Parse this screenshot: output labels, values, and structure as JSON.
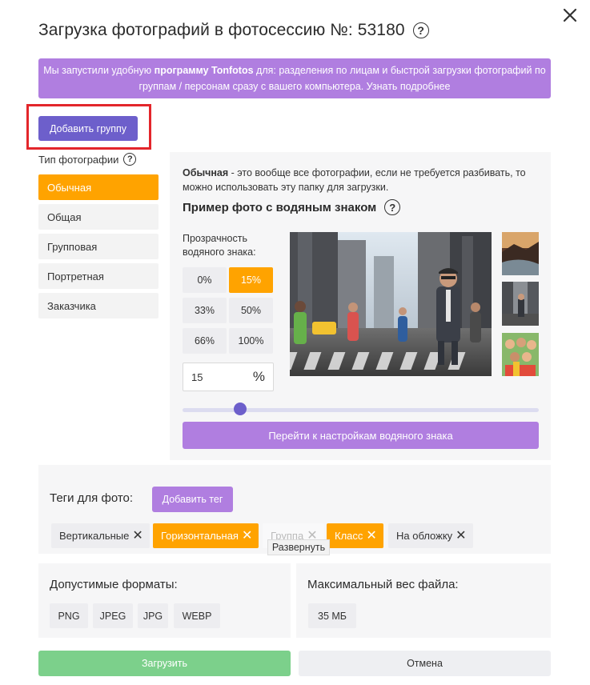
{
  "dialog": {
    "title": "Загрузка фотографий в фотосессию №: 53180",
    "help_icon": "?"
  },
  "banner": {
    "text_before": "Мы запустили удобную",
    "text_bold": "программу Tonfotos",
    "text_after": "для: разделения по лицам и быстрой загрузки фотографий по группам / персонам сразу с вашего компьютера. Узнать подробнее"
  },
  "add_group_label": "Добавить группу",
  "photo_types": {
    "label": "Тип фотографии",
    "items": [
      {
        "label": "Обычная",
        "active": true
      },
      {
        "label": "Общая",
        "active": false
      },
      {
        "label": "Групповая",
        "active": false
      },
      {
        "label": "Портретная",
        "active": false
      },
      {
        "label": "Заказчика",
        "active": false
      }
    ]
  },
  "description": {
    "bold": "Обычная",
    "text": " - это вообще все фотографии, если не требуется разбивать, то можно использовать эту папку для загрузки."
  },
  "watermark": {
    "title": "Пример фото с водяным знаком",
    "opacity_label": "Прозрачность водяного знака:",
    "options": [
      "0%",
      "15%",
      "33%",
      "50%",
      "66%",
      "100%"
    ],
    "selected": "15%",
    "input_value": "15",
    "unit": "%",
    "slider_value_percent": 15,
    "settings_button": "Перейти к настройкам водяного знака"
  },
  "tags": {
    "title": "Теги для фото:",
    "add_label": "Добавить тег",
    "items": [
      {
        "label": "Вертикальные",
        "style": "plain"
      },
      {
        "label": "Горизонтальная",
        "style": "orange"
      },
      {
        "label": "Группа",
        "style": "ghost"
      },
      {
        "label": "Класс",
        "style": "orange"
      },
      {
        "label": "На обложку",
        "style": "plain"
      }
    ],
    "tooltip": "Развернуть"
  },
  "formats": {
    "title": "Допустимые форматы:",
    "items": [
      "PNG",
      "JPEG",
      "JPG",
      "WEBP"
    ]
  },
  "max_weight": {
    "title": "Максимальный вес файла:",
    "value": "35 МБ"
  },
  "actions": {
    "upload": "Загрузить",
    "cancel": "Отмена"
  },
  "colors": {
    "accent_purple": "#b07ee0",
    "button_indigo": "#6d5fcb",
    "active_orange": "#ffa300",
    "upload_green": "#7cd08b",
    "highlight_red": "#e3262b"
  }
}
